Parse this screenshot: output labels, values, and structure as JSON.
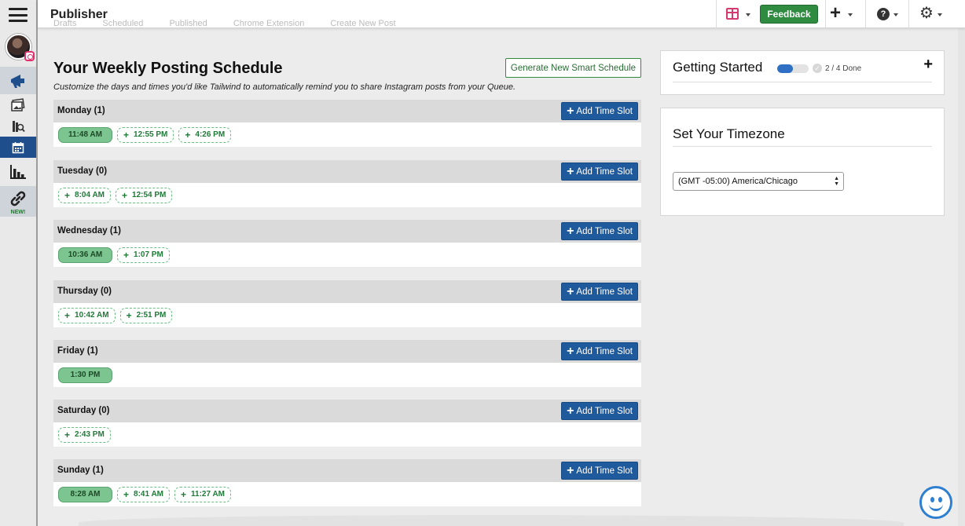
{
  "app": {
    "title": "Publisher"
  },
  "faded_tabs": [
    "Drafts",
    "Scheduled",
    "Published",
    "Chrome Extension",
    "Create New Post"
  ],
  "header": {
    "feedback_label": "Feedback"
  },
  "sidebar": {
    "new_label": "NEW!"
  },
  "schedule": {
    "title": "Your Weekly Posting Schedule",
    "subtitle": "Customize the days and times you'd like Tailwind to automatically remind you to share Instagram posts from your Queue.",
    "smart_button": "Generate New Smart Schedule",
    "add_slot_label": "Add Time Slot",
    "days": [
      {
        "label": "Monday (1)",
        "slots": [
          {
            "time": "11:48 AM",
            "filled": true
          },
          {
            "time": "12:55 PM",
            "filled": false
          },
          {
            "time": "4:26 PM",
            "filled": false
          }
        ]
      },
      {
        "label": "Tuesday (0)",
        "slots": [
          {
            "time": "8:04 AM",
            "filled": false
          },
          {
            "time": "12:54 PM",
            "filled": false
          }
        ]
      },
      {
        "label": "Wednesday (1)",
        "slots": [
          {
            "time": "10:36 AM",
            "filled": true
          },
          {
            "time": "1:07 PM",
            "filled": false
          }
        ]
      },
      {
        "label": "Thursday (0)",
        "slots": [
          {
            "time": "10:42 AM",
            "filled": false
          },
          {
            "time": "2:51 PM",
            "filled": false
          }
        ]
      },
      {
        "label": "Friday (1)",
        "slots": [
          {
            "time": "1:30 PM",
            "filled": true
          }
        ]
      },
      {
        "label": "Saturday (0)",
        "slots": [
          {
            "time": "2:43 PM",
            "filled": false
          }
        ]
      },
      {
        "label": "Sunday (1)",
        "slots": [
          {
            "time": "8:28 AM",
            "filled": true
          },
          {
            "time": "8:41 AM",
            "filled": false
          },
          {
            "time": "11:27 AM",
            "filled": false
          }
        ]
      }
    ]
  },
  "getting_started": {
    "title": "Getting Started",
    "progress_text": "2 / 4 Done",
    "progress_fraction": 0.5
  },
  "timezone": {
    "title": "Set Your Timezone",
    "selected": "(GMT -05:00) America/Chicago"
  },
  "colors": {
    "primary_blue": "#1e5a9c",
    "green": "#2e8b3f",
    "slot_filled": "#7cc490"
  }
}
